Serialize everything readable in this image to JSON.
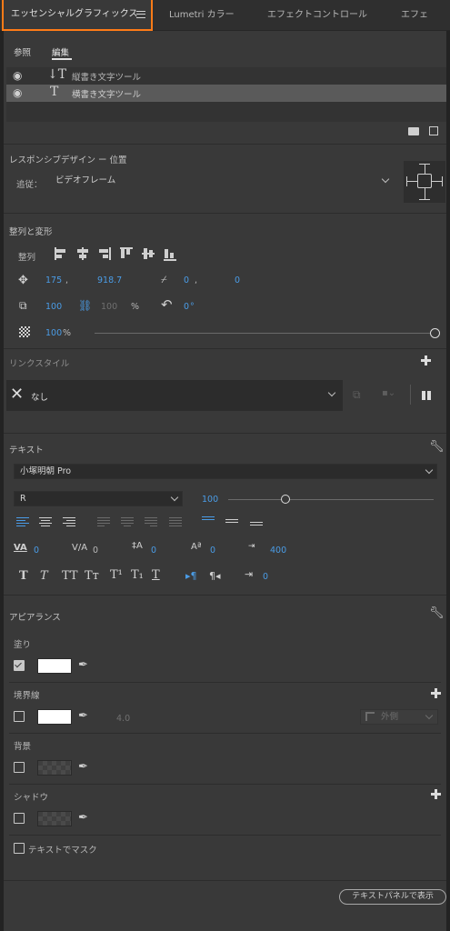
{
  "tabs": [
    {
      "label": "エッセンシャルグラフィックス"
    },
    {
      "label": "Lumetri カラー"
    },
    {
      "label": "エフェクトコントロール"
    },
    {
      "label": "エフェ"
    }
  ],
  "subtabs": {
    "browse": "参照",
    "edit": "編集"
  },
  "layers": [
    {
      "glyph": "↓T",
      "name": "縦書き文字ツール"
    },
    {
      "glyph": "T",
      "name": "横書き文字ツール"
    }
  ],
  "responsive": {
    "title": "レスポンシブデザイン ー 位置",
    "follow_label": "追従：",
    "follow_value": "ビデオフレーム"
  },
  "align": {
    "title": "整列と変形",
    "align_label": "整列",
    "pos_x": "175",
    "pos_y": "918.7",
    "anchor_x": "0",
    "anchor_y": "0",
    "scale": "100",
    "scale_h": "100",
    "scale_unit": "%",
    "rotation": "0",
    "rotation_unit": "°",
    "opacity": "100",
    "opacity_unit": "%",
    "opacity_fraction": 1.0
  },
  "link_style": {
    "title": "リンクスタイル",
    "value": "なし"
  },
  "text": {
    "title": "テキスト",
    "font": "小塚明朝 Pro",
    "style": "R",
    "size": "100",
    "size_fraction": 0.28,
    "kerning": "0",
    "tracking": "0",
    "leading": "0",
    "baseline": "0",
    "tsume": "400",
    "indent": "0",
    "style_buttons": [
      "T",
      "T",
      "TT",
      "Tт",
      "T¹",
      "T₁",
      "T"
    ]
  },
  "appearance": {
    "title": "アピアランス",
    "fill": "塗り",
    "stroke": "境界線",
    "stroke_width": "4.0",
    "stroke_position": "外側",
    "background": "背景",
    "shadow": "シャドウ",
    "mask": "テキストでマスク"
  },
  "footer": {
    "text_panel_button": "テキストパネルで表示"
  },
  "colors": {
    "accent": "#ff7b17",
    "blue": "#4a9ce6",
    "panel": "#393939",
    "white": "#ffffff"
  }
}
